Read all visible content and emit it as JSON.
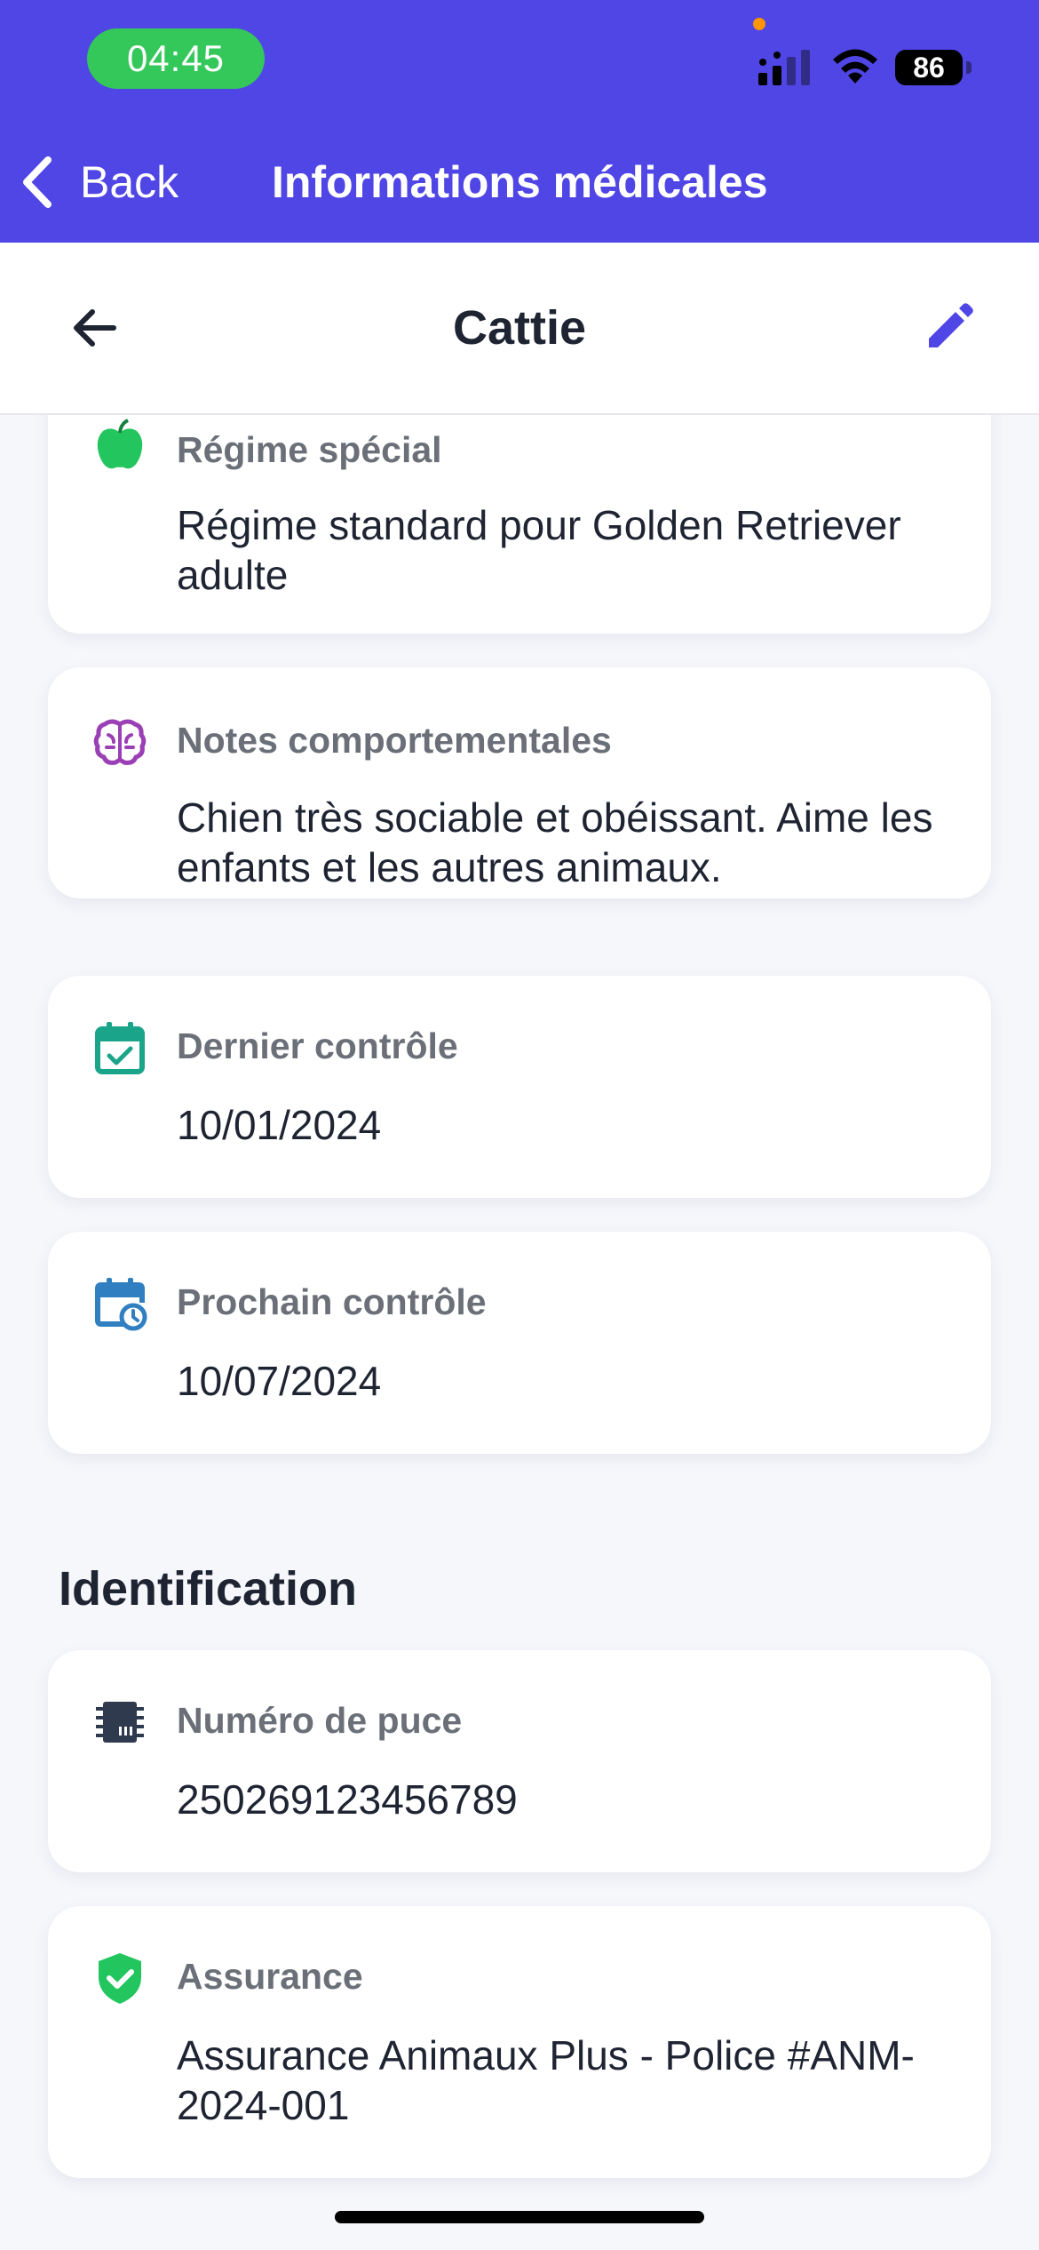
{
  "status_bar": {
    "time": "04:45",
    "battery": "86",
    "icons": [
      "signal-icon",
      "wifi-icon",
      "battery-icon"
    ]
  },
  "nav_bar": {
    "back_label": "Back",
    "title": "Informations médicales"
  },
  "header": {
    "title": "Cattie",
    "back_icon": "arrow-left-icon",
    "edit_icon": "pencil-icon"
  },
  "cards": [
    {
      "label": "Régime spécial",
      "value": "Régime standard pour Golden Retriever adulte",
      "icon": "apple-icon",
      "icon_color": "#22c55e"
    },
    {
      "label": "Notes comportementales",
      "value": "Chien très sociable et obéissant. Aime les enfants et les autres animaux.",
      "icon": "brain-icon",
      "icon_color": "#9b3fb5"
    },
    {
      "label": "Dernier contrôle",
      "value": "10/01/2024",
      "icon": "calendar-check-icon",
      "icon_color": "#1aa58a"
    },
    {
      "label": "Prochain contrôle",
      "value": "10/07/2024",
      "icon": "calendar-clock-icon",
      "icon_color": "#2f7fc1"
    }
  ],
  "identification": {
    "title": "Identification",
    "cards": [
      {
        "label": "Numéro de puce",
        "value": "250269123456789",
        "icon": "chip-icon",
        "icon_color": "#2f3a4f"
      },
      {
        "label": "Assurance",
        "value": "Assurance Animaux Plus - Police #ANM-2024-001",
        "icon": "shield-check-icon",
        "icon_color": "#22c55e"
      }
    ]
  },
  "colors": {
    "primary": "#4f46e5",
    "background": "#f6f7fb",
    "time_pill": "#34c759"
  }
}
